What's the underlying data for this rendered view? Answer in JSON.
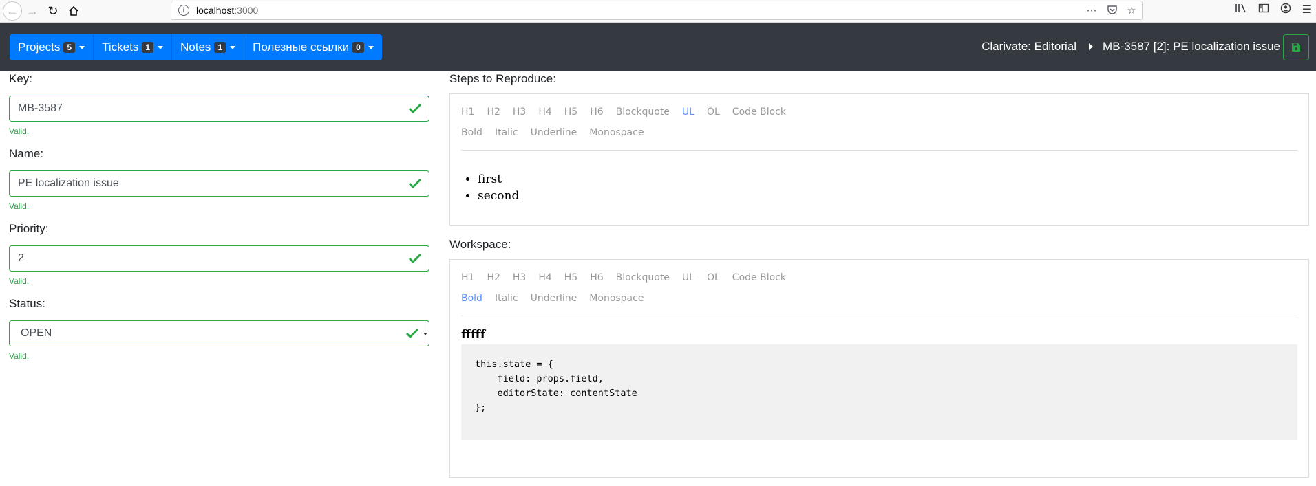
{
  "browser": {
    "url_host": "localhost",
    "url_port": ":3000"
  },
  "navbar": {
    "menus": [
      {
        "label": "Projects",
        "count": "5"
      },
      {
        "label": "Tickets",
        "count": "1"
      },
      {
        "label": "Notes",
        "count": "1"
      },
      {
        "label": "Полезные ссылки",
        "count": "0"
      }
    ],
    "breadcrumb": {
      "project": "Clarivate: Editorial",
      "ticket": "MB-3587 [2]: PE localization issue"
    }
  },
  "form": {
    "key": {
      "label": "Key:",
      "value": "MB-3587",
      "feedback": "Valid."
    },
    "name": {
      "label": "Name:",
      "value": "PE localization issue",
      "feedback": "Valid."
    },
    "priority": {
      "label": "Priority:",
      "value": "2",
      "feedback": "Valid."
    },
    "status": {
      "label": "Status:",
      "value": "OPEN",
      "feedback": "Valid."
    }
  },
  "editors": {
    "toolbar_blocks": [
      "H1",
      "H2",
      "H3",
      "H4",
      "H5",
      "H6",
      "Blockquote",
      "UL",
      "OL",
      "Code Block"
    ],
    "toolbar_inline": [
      "Bold",
      "Italic",
      "Underline",
      "Monospace"
    ],
    "steps": {
      "label": "Steps to Reproduce:",
      "active_block": "UL",
      "items": [
        "first",
        "second"
      ]
    },
    "workspace": {
      "label": "Workspace:",
      "active_inline": "Bold",
      "bold_text": "fffff",
      "code": "this.state = {\n    field: props.field,\n    editorState: contentState\n};"
    }
  },
  "colors": {
    "navbar_bg": "#343a40",
    "primary": "#007bff",
    "success": "#28a745",
    "toolbar_active": "#5890ff"
  }
}
